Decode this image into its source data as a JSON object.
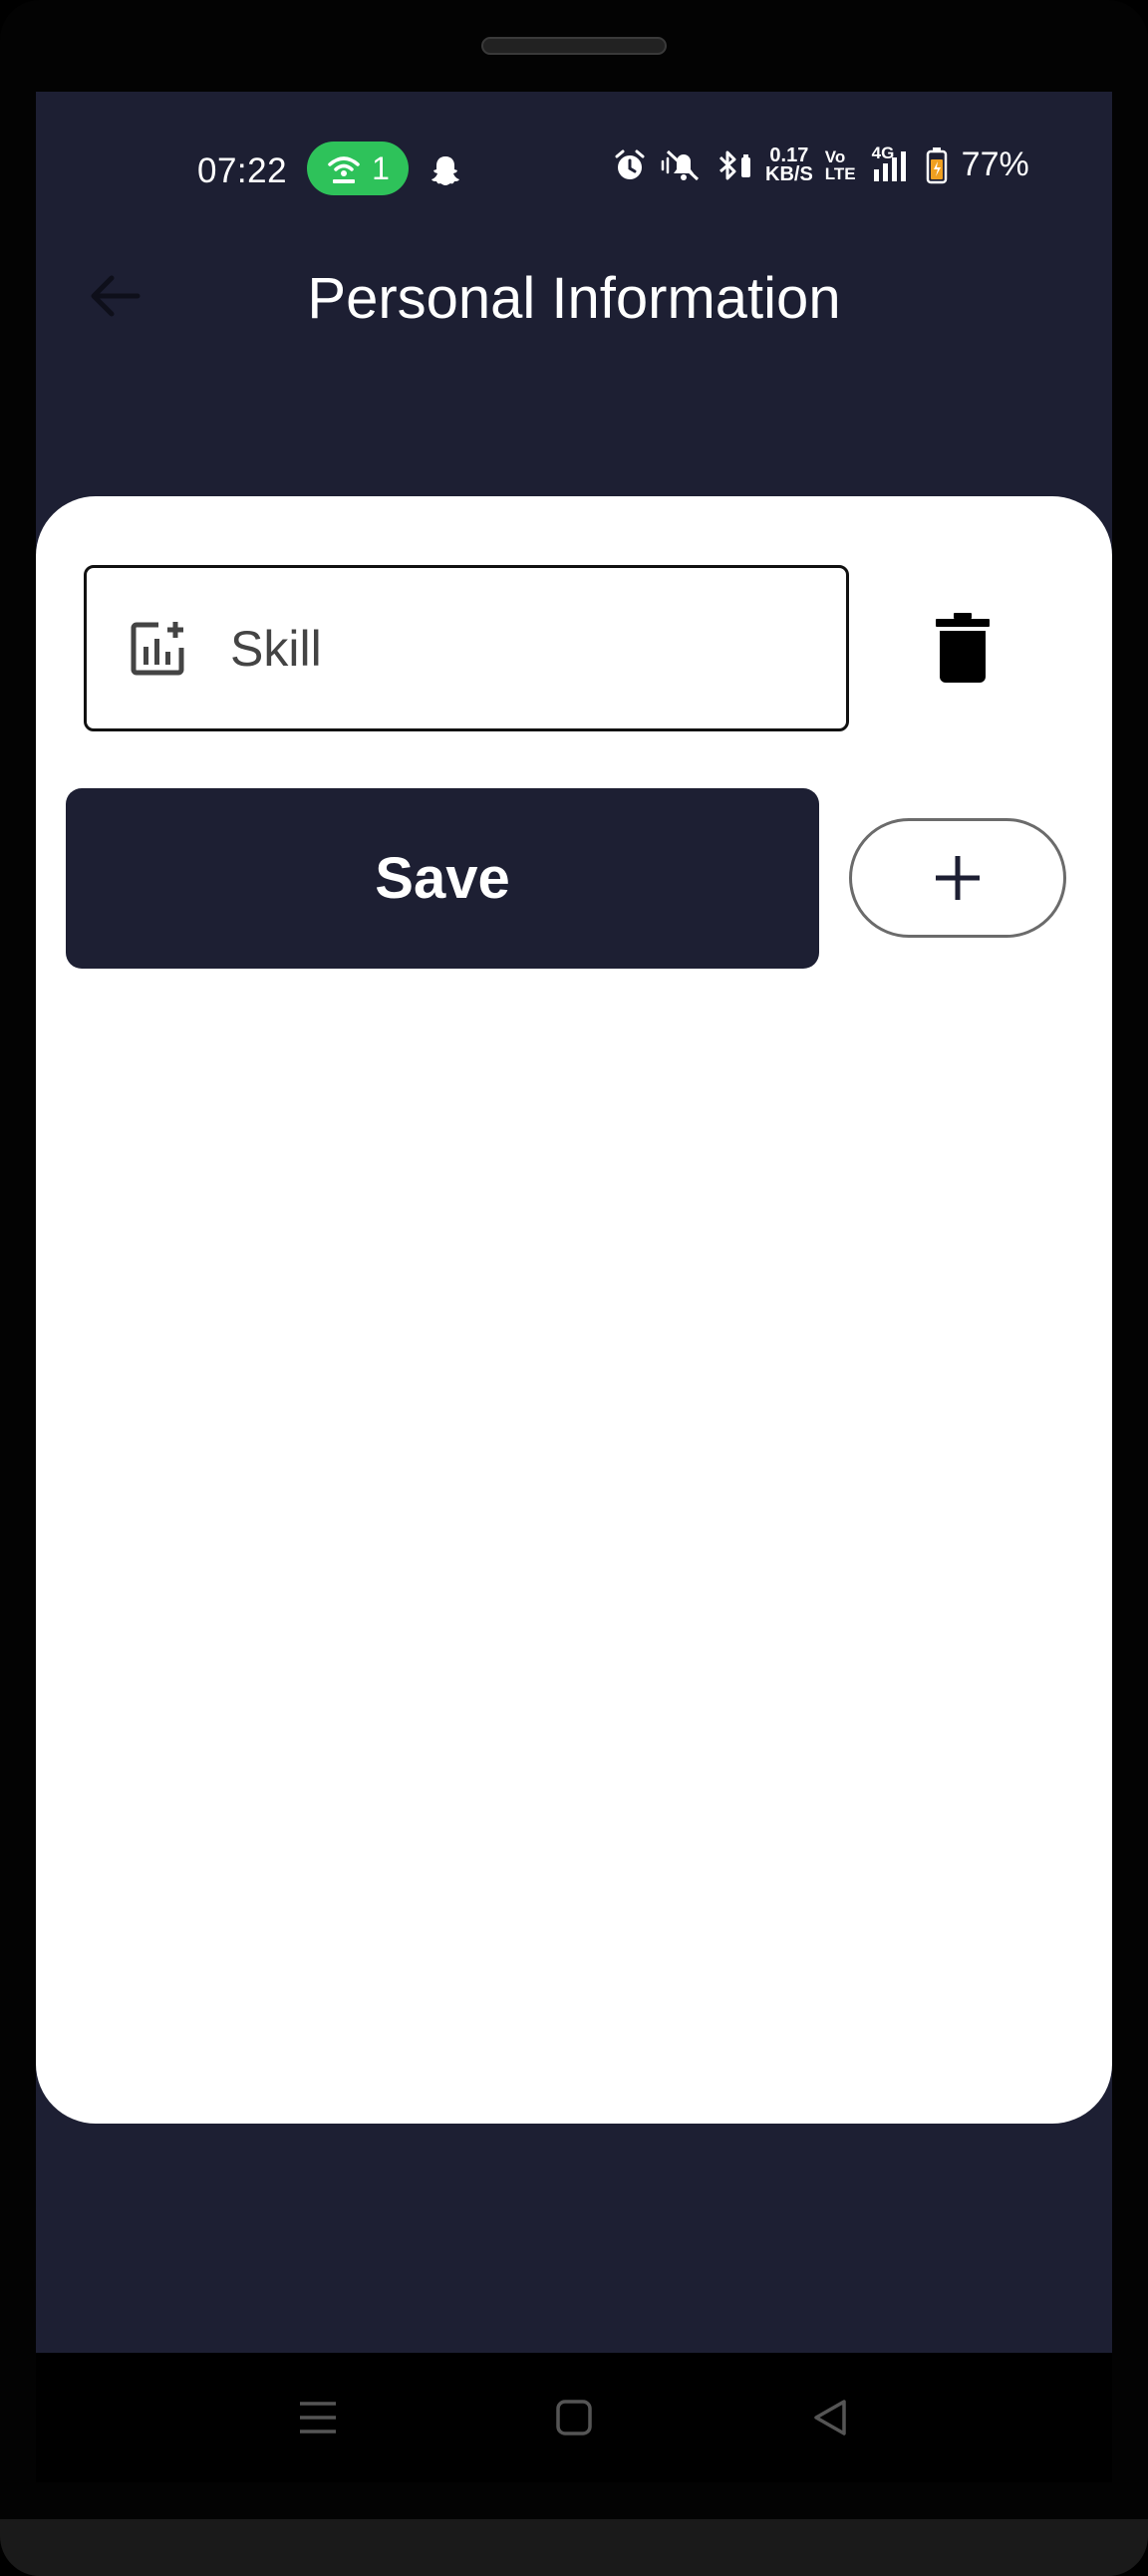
{
  "status_bar": {
    "time": "07:22",
    "hotspot_count": "1",
    "net_speed_value": "0.17",
    "net_speed_unit": "KB/S",
    "volte_top": "Vo",
    "volte_bottom": "LTE",
    "network_type": "4G",
    "battery": "77%",
    "hotspot_color": "#2ec25a"
  },
  "app_bar": {
    "title": "Personal Information",
    "back_icon": "arrow-left-icon"
  },
  "form": {
    "skill_placeholder": "Skill",
    "skill_value": "",
    "skill_icon": "chart-add-icon",
    "delete_icon": "trash-icon",
    "save_label": "Save",
    "add_icon": "plus-icon"
  },
  "nav_bar": {
    "menu_icon": "menu-icon",
    "home_icon": "home-icon",
    "back_icon": "back-triangle-icon"
  },
  "colors": {
    "primary": "#1d1f33",
    "card": "#ffffff"
  }
}
